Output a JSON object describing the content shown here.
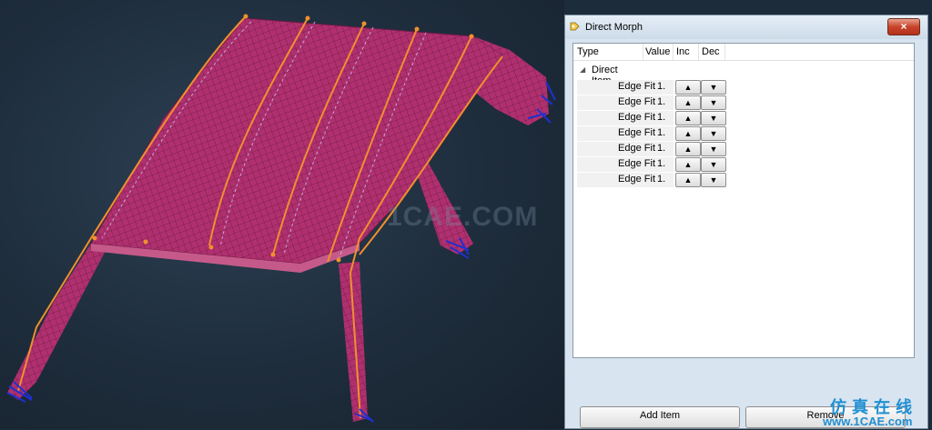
{
  "viewport": {
    "watermark": "1CAE.COM"
  },
  "dialog": {
    "title": "Direct Morph",
    "close_glyph": "×",
    "columns": [
      "Type",
      "Value",
      "Inc",
      "Dec"
    ],
    "group": {
      "label": "Direct Item",
      "expanded": true
    },
    "items": [
      {
        "type": "Edge Fit",
        "value": "1."
      },
      {
        "type": "Edge Fit",
        "value": "1."
      },
      {
        "type": "Edge Fit",
        "value": "1."
      },
      {
        "type": "Edge Fit",
        "value": "1."
      },
      {
        "type": "Edge Fit",
        "value": "1."
      },
      {
        "type": "Edge Fit",
        "value": "1."
      },
      {
        "type": "Edge Fit",
        "value": "1."
      }
    ],
    "inc_glyph": "▲",
    "dec_glyph": "▼",
    "bottom_buttons": [
      "Add Item",
      "Remove"
    ]
  },
  "brand": {
    "cn": "仿真在线",
    "url": "www.1CAE.com"
  },
  "colors": {
    "mesh": "#b0306f",
    "curve": "#f0902e",
    "anchor": "#2030d0"
  }
}
